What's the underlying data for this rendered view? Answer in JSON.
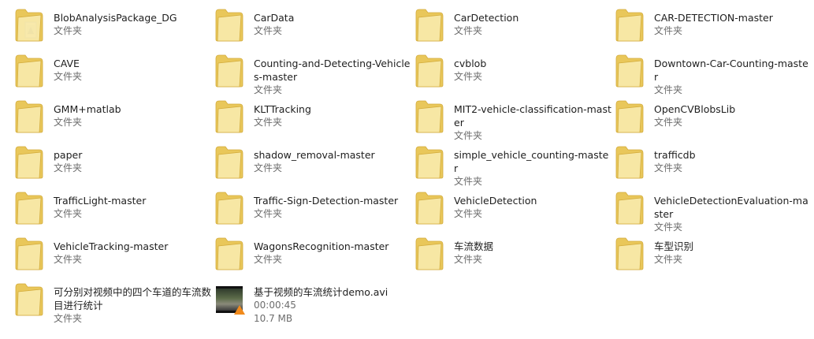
{
  "colors": {
    "folder_back": "#e9c75a",
    "folder_front": "#f8e9a8",
    "folder_edge": "#d3ab3b",
    "vlc_cone": "#f18a1c",
    "subtitle_gray": "#6d6d6d"
  },
  "items": [
    {
      "name": "BlobAnalysisPackage_DG",
      "sub": "文件夹",
      "icon": "matlab-folder-icon"
    },
    {
      "name": "CarData",
      "sub": "文件夹",
      "icon": "folder-icon"
    },
    {
      "name": "CarDetection",
      "sub": "文件夹",
      "icon": "folder-icon"
    },
    {
      "name": "CAR-DETECTION-master",
      "sub": "文件夹",
      "icon": "folder-icon"
    },
    {
      "name": "CAVE",
      "sub": "文件夹",
      "icon": "folder-icon"
    },
    {
      "name": "Counting-and-Detecting-Vehicles-master",
      "sub": "文件夹",
      "icon": "folder-icon"
    },
    {
      "name": "cvblob",
      "sub": "文件夹",
      "icon": "folder-icon"
    },
    {
      "name": "Downtown-Car-Counting-master",
      "sub": "文件夹",
      "icon": "folder-icon"
    },
    {
      "name": "GMM+matlab",
      "sub": "文件夹",
      "icon": "folder-icon"
    },
    {
      "name": "KLTTracking",
      "sub": "文件夹",
      "icon": "folder-icon"
    },
    {
      "name": "MIT2-vehicle-classification-master",
      "sub": "文件夹",
      "icon": "folder-icon"
    },
    {
      "name": "OpenCVBlobsLib",
      "sub": "文件夹",
      "icon": "folder-icon"
    },
    {
      "name": "paper",
      "sub": "文件夹",
      "icon": "folder-icon"
    },
    {
      "name": "shadow_removal-master",
      "sub": "文件夹",
      "icon": "folder-icon"
    },
    {
      "name": "simple_vehicle_counting-master",
      "sub": "文件夹",
      "icon": "folder-icon"
    },
    {
      "name": "trafficdb",
      "sub": "文件夹",
      "icon": "folder-icon"
    },
    {
      "name": "TrafficLight-master",
      "sub": "文件夹",
      "icon": "folder-icon"
    },
    {
      "name": "Traffic-Sign-Detection-master",
      "sub": "文件夹",
      "icon": "folder-icon"
    },
    {
      "name": "VehicleDetection",
      "sub": "文件夹",
      "icon": "folder-icon"
    },
    {
      "name": "VehicleDetectionEvaluation-master",
      "sub": "文件夹",
      "icon": "folder-icon"
    },
    {
      "name": "VehicleTracking-master",
      "sub": "文件夹",
      "icon": "folder-icon"
    },
    {
      "name": "WagonsRecognition-master",
      "sub": "文件夹",
      "icon": "folder-icon"
    },
    {
      "name": "车流数据",
      "sub": "文件夹",
      "icon": "folder-icon"
    },
    {
      "name": "车型识别",
      "sub": "文件夹",
      "icon": "folder-icon"
    },
    {
      "name": "可分别对视频中的四个车道的车流数目进行统计",
      "sub": "文件夹",
      "icon": "folder-icon"
    },
    {
      "name": "基于视频的车流统计demo.avi",
      "sub": "00:00:45",
      "sub2": "10.7 MB",
      "icon": "video-file-icon"
    }
  ]
}
